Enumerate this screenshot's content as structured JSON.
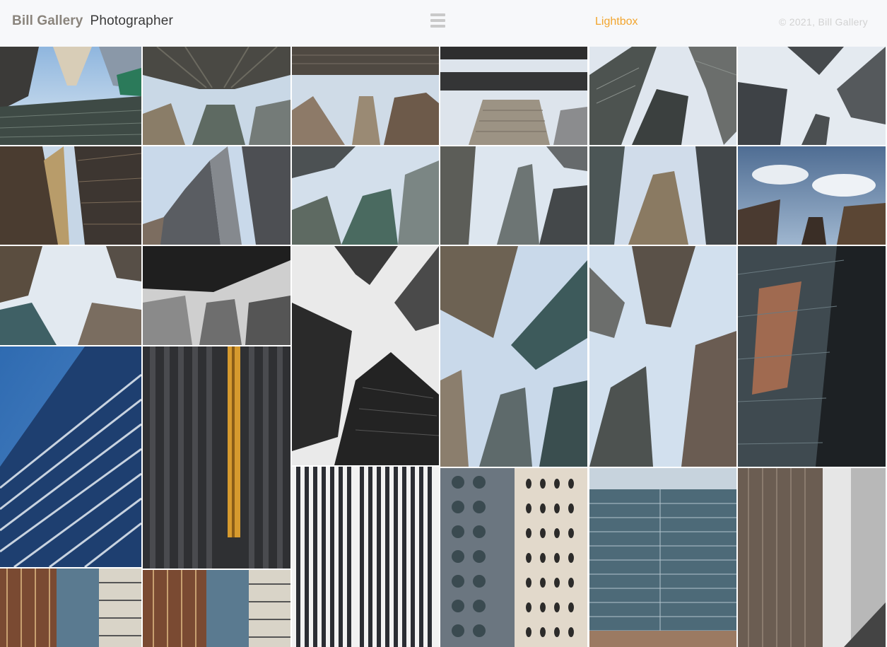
{
  "header": {
    "brand_name": "Bill Gallery",
    "brand_subtitle": "Photographer",
    "menu_icon": "hamburger-menu-icon",
    "lightbox_label": "Lightbox",
    "copyright": "© 2021, Bill Gallery"
  },
  "colors": {
    "header_bg": "#f7f8fa",
    "brand_name": "#8a847c",
    "lightbox_accent": "#f2a52e",
    "copyright": "#d2d2d2",
    "menu_icon": "#c9c9c9"
  },
  "gallery": {
    "subject": "skyscraper photographs",
    "tile_count": 27
  }
}
